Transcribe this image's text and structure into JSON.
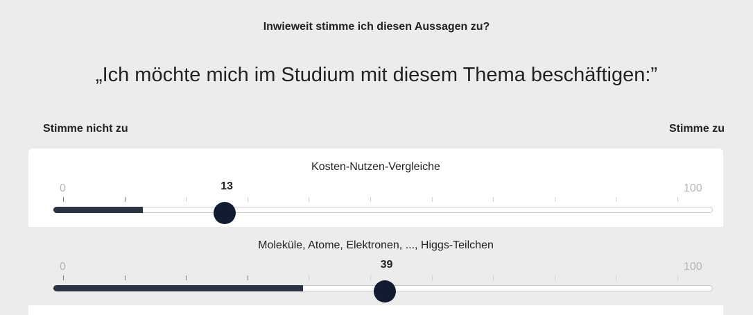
{
  "header": {
    "question": "Inwieweit stimme ich diesen Aussagen zu?",
    "statement": "„Ich möchte mich im Studium mit diesem Thema beschäftigen:”"
  },
  "scale": {
    "left_label": "Stimme nicht zu",
    "right_label": "Stimme zu"
  },
  "sliders": [
    {
      "title": "Kosten-Nutzen-Vergleiche",
      "min": "0",
      "max": "100",
      "value": 13
    },
    {
      "title": "Moleküle, Atome, Elektronen, ..., Higgs-Teilchen",
      "min": "0",
      "max": "100",
      "value": 39
    }
  ],
  "colors": {
    "background": "#ececec",
    "fill": "#2a3342",
    "thumb": "#111c33"
  }
}
